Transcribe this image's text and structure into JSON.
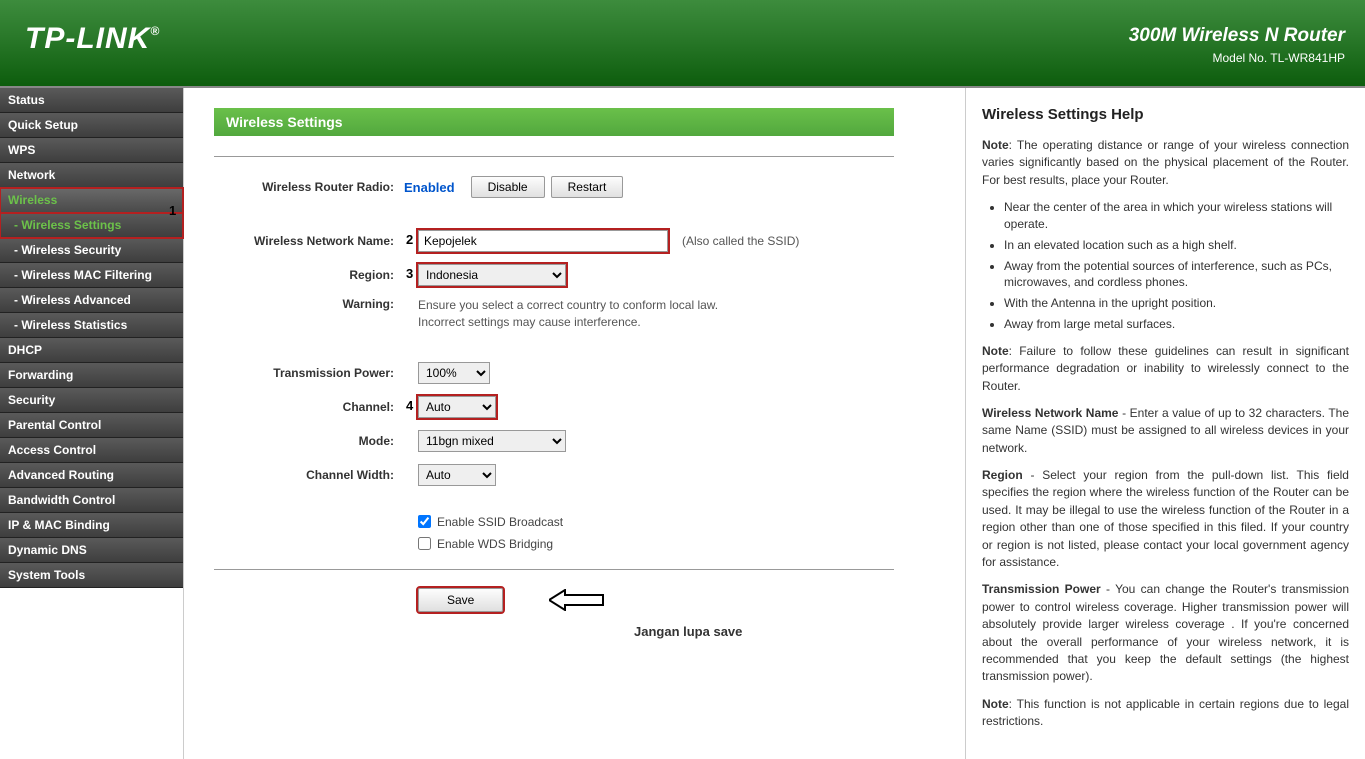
{
  "header": {
    "logo": "TP-LINK",
    "title": "300M Wireless N Router",
    "model": "Model No. TL-WR841HP"
  },
  "sidebar": {
    "items": [
      {
        "label": "Status",
        "type": "top"
      },
      {
        "label": "Quick Setup",
        "type": "top"
      },
      {
        "label": "WPS",
        "type": "top"
      },
      {
        "label": "Network",
        "type": "top"
      },
      {
        "label": "Wireless",
        "type": "top",
        "activeParent": true
      },
      {
        "label": "- Wireless Settings",
        "type": "sub",
        "activeChild": true
      },
      {
        "label": "- Wireless Security",
        "type": "sub"
      },
      {
        "label": "- Wireless MAC Filtering",
        "type": "sub"
      },
      {
        "label": "- Wireless Advanced",
        "type": "sub"
      },
      {
        "label": "- Wireless Statistics",
        "type": "sub"
      },
      {
        "label": "DHCP",
        "type": "top"
      },
      {
        "label": "Forwarding",
        "type": "top"
      },
      {
        "label": "Security",
        "type": "top"
      },
      {
        "label": "Parental Control",
        "type": "top"
      },
      {
        "label": "Access Control",
        "type": "top"
      },
      {
        "label": "Advanced Routing",
        "type": "top"
      },
      {
        "label": "Bandwidth Control",
        "type": "top"
      },
      {
        "label": "IP & MAC Binding",
        "type": "top"
      },
      {
        "label": "Dynamic DNS",
        "type": "top"
      },
      {
        "label": "System Tools",
        "type": "top"
      }
    ]
  },
  "page": {
    "title": "Wireless Settings",
    "radio_label": "Wireless Router Radio:",
    "radio_status": "Enabled",
    "disable_btn": "Disable",
    "restart_btn": "Restart",
    "ssid_label": "Wireless Network Name:",
    "ssid_value": "Kepojelek",
    "ssid_hint": "(Also called the SSID)",
    "region_label": "Region:",
    "region_value": "Indonesia",
    "warning_label": "Warning:",
    "warning_text1": "Ensure you select a correct country to conform local law.",
    "warning_text2": "Incorrect settings may cause interference.",
    "tx_label": "Transmission Power:",
    "tx_value": "100%",
    "channel_label": "Channel:",
    "channel_value": "Auto",
    "mode_label": "Mode:",
    "mode_value": "11bgn mixed",
    "width_label": "Channel Width:",
    "width_value": "Auto",
    "ssid_broadcast_label": "Enable SSID Broadcast",
    "wds_label": "Enable WDS Bridging",
    "save_btn": "Save",
    "save_hint": "Jangan lupa save",
    "annot1": "1",
    "annot2": "2",
    "annot3": "3",
    "annot4": "4"
  },
  "help": {
    "title": "Wireless Settings Help",
    "p1": "Note: The operating distance or range of your wireless connection varies significantly based on the physical placement of the Router. For best results, place your Router.",
    "bullets": [
      "Near the center of the area in which your wireless stations will operate.",
      "In an elevated location such as a high shelf.",
      "Away from the potential sources of interference, such as PCs, microwaves, and cordless phones.",
      "With the Antenna in the upright position.",
      "Away from large metal surfaces."
    ],
    "p2": "Note: Failure to follow these guidelines can result in significant performance degradation or inability to wirelessly connect to the Router.",
    "p3": "Wireless Network Name - Enter a value of up to 32 characters. The same Name (SSID) must be assigned to all wireless devices in your network.",
    "p4": "Region - Select your region from the pull-down list. This field specifies the region where the wireless function of the Router can be used. It may be illegal to use the wireless function of the Router in a region other than one of those specified in this filed. If your country or region is not listed, please contact your local government agency for assistance.",
    "p5": "Transmission Power - You can change the Router's transmission power to control wireless coverage. Higher transmission power will absolutely provide larger wireless coverage . If you're concerned about the overall performance of your wireless network, it is recommended that you keep the default settings (the highest transmission power).",
    "p6": "Note: This function is not applicable in certain regions due to legal restrictions."
  }
}
